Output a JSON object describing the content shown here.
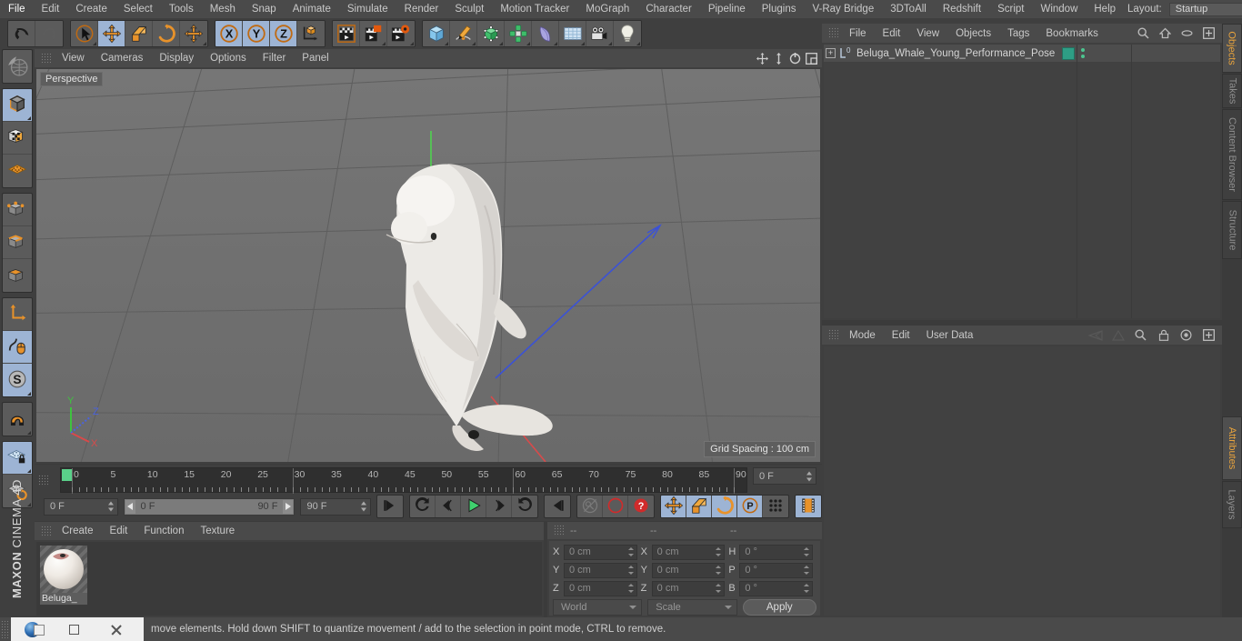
{
  "app": {
    "brand_maxon": "MAXON",
    "brand_product": "CINEMA 4D"
  },
  "menubar": {
    "items": [
      "File",
      "Edit",
      "Create",
      "Select",
      "Tools",
      "Mesh",
      "Snap",
      "Animate",
      "Simulate",
      "Render",
      "Sculpt",
      "Motion Tracker",
      "MoGraph",
      "Character",
      "Pipeline",
      "Plugins",
      "V-Ray Bridge",
      "3DToAll",
      "Redshift",
      "Script",
      "Window",
      "Help"
    ],
    "layout_label": "Layout:",
    "layout_value": "Startup",
    "icons": [
      "search-icon",
      "home-icon",
      "minimize-icon",
      "maximize-icon"
    ]
  },
  "toolbar": {
    "groups": [
      {
        "name": "undo-redo",
        "buttons": [
          {
            "name": "undo-button",
            "icon": "undo-arrow-icon",
            "active": false,
            "corner": false
          },
          {
            "name": "redo-button",
            "icon": "redo-arrow-icon",
            "active": false,
            "corner": false
          }
        ]
      },
      {
        "name": "transform-tools",
        "buttons": [
          {
            "name": "live-selection-tool",
            "icon": "cursor-circle-icon",
            "active": false,
            "corner": true
          },
          {
            "name": "move-tool",
            "icon": "move-arrows-icon",
            "active": true,
            "corner": false
          },
          {
            "name": "scale-tool",
            "icon": "scale-box-icon",
            "active": false,
            "corner": false
          },
          {
            "name": "rotate-tool",
            "icon": "rotate-arc-icon",
            "active": false,
            "corner": false
          },
          {
            "name": "dynamic-place-tool",
            "icon": "move-arrows-icon",
            "active": false,
            "corner": true
          }
        ]
      },
      {
        "name": "axis-locks",
        "buttons": [
          {
            "name": "lock-x-axis",
            "icon": "x-axis-icon",
            "active": true,
            "corner": false
          },
          {
            "name": "lock-y-axis",
            "icon": "y-axis-icon",
            "active": true,
            "corner": false
          },
          {
            "name": "lock-z-axis",
            "icon": "z-axis-icon",
            "active": true,
            "corner": false
          },
          {
            "name": "world-object-coordinates",
            "icon": "world-axis-cube-icon",
            "active": false,
            "corner": false
          }
        ]
      },
      {
        "name": "render-tools",
        "buttons": [
          {
            "name": "render-view-button",
            "icon": "render-view-icon",
            "active": false,
            "corner": false
          },
          {
            "name": "render-region-button",
            "icon": "render-region-icon",
            "active": false,
            "corner": true
          },
          {
            "name": "render-settings-button",
            "icon": "render-settings-gear-icon",
            "active": false,
            "corner": true
          }
        ]
      },
      {
        "name": "create-objects",
        "buttons": [
          {
            "name": "add-cube-button",
            "icon": "cube-icon",
            "active": false,
            "corner": true
          },
          {
            "name": "add-spline-button",
            "icon": "pen-spline-icon",
            "active": false,
            "corner": true
          },
          {
            "name": "add-generator-button",
            "icon": "green-cube-generator-icon",
            "active": false,
            "corner": true
          },
          {
            "name": "add-array-button",
            "icon": "array-cluster-icon",
            "active": false,
            "corner": true
          },
          {
            "name": "add-deformer-button",
            "icon": "bend-deformer-icon",
            "active": false,
            "corner": true
          },
          {
            "name": "add-environment-button",
            "icon": "floor-grid-icon",
            "active": false,
            "corner": true
          },
          {
            "name": "add-camera-button",
            "icon": "camera-icon",
            "active": false,
            "corner": true
          },
          {
            "name": "add-light-button",
            "icon": "light-bulb-icon",
            "active": false,
            "corner": true
          }
        ]
      }
    ]
  },
  "left_tools": {
    "groups": [
      {
        "name": "undo-view",
        "buttons": [
          {
            "name": "undo-view-button",
            "icon": "globe-grid-icon",
            "active": false,
            "corner": false
          }
        ]
      },
      {
        "name": "editor-modes",
        "buttons": [
          {
            "name": "make-editable-button",
            "icon": "gray-cube-icon",
            "active": true,
            "corner": true
          },
          {
            "name": "texture-mode-button",
            "icon": "checker-cube-icon",
            "active": false,
            "corner": false
          },
          {
            "name": "viewport-solo-button",
            "icon": "orange-grid-plane-icon",
            "active": false,
            "corner": false
          }
        ]
      },
      {
        "name": "component-modes",
        "buttons": [
          {
            "name": "points-mode-button",
            "icon": "cube-points-icon",
            "active": false,
            "corner": false
          },
          {
            "name": "edges-mode-button",
            "icon": "cube-edges-icon",
            "active": false,
            "corner": false
          },
          {
            "name": "polygons-mode-button",
            "icon": "cube-polygons-icon",
            "active": false,
            "corner": false
          }
        ]
      },
      {
        "name": "axis-modes",
        "buttons": [
          {
            "name": "enable-axis-button",
            "icon": "axis-corner-icon",
            "active": false,
            "corner": false
          },
          {
            "name": "enable-snap-button",
            "icon": "mouse-spline-icon",
            "active": true,
            "corner": false
          },
          {
            "name": "soft-selection-button",
            "icon": "s-circle-icon",
            "active": true,
            "corner": true
          }
        ]
      },
      {
        "name": "magnet-group",
        "buttons": [
          {
            "name": "magnet-tool-button",
            "icon": "magnet-icon",
            "active": false,
            "corner": true
          }
        ]
      },
      {
        "name": "workplane-group",
        "buttons": [
          {
            "name": "lock-workplane-button",
            "icon": "workplane-lock-icon",
            "active": true,
            "corner": true
          },
          {
            "name": "workplane-rotate-button",
            "icon": "workplane-rotate-icon",
            "active": false,
            "corner": true
          }
        ]
      }
    ]
  },
  "viewport": {
    "menu": [
      "View",
      "Cameras",
      "Display",
      "Options",
      "Filter",
      "Panel"
    ],
    "nav_icons": [
      "pan-icon",
      "dolly-icon",
      "orbit-icon",
      "maximize-view-icon"
    ],
    "label": "Perspective",
    "grid_spacing": "Grid Spacing : 100 cm",
    "axis_labels": {
      "x": "X",
      "y": "Y",
      "z": "Z"
    },
    "axis_colors": {
      "x": "#d84a4a",
      "y": "#3fc23f",
      "z": "#4a63e0"
    },
    "subject": "beluga-whale-model"
  },
  "timeline": {
    "ticks": [
      {
        "label": "0",
        "value": 0
      },
      {
        "label": "5",
        "value": 5
      },
      {
        "label": "10",
        "value": 10
      },
      {
        "label": "15",
        "value": 15
      },
      {
        "label": "20",
        "value": 20
      },
      {
        "label": "25",
        "value": 25
      },
      {
        "label": "30",
        "value": 30
      },
      {
        "label": "35",
        "value": 35
      },
      {
        "label": "40",
        "value": 40
      },
      {
        "label": "45",
        "value": 45
      },
      {
        "label": "50",
        "value": 50
      },
      {
        "label": "55",
        "value": 55
      },
      {
        "label": "60",
        "value": 60
      },
      {
        "label": "65",
        "value": 65
      },
      {
        "label": "70",
        "value": 70
      },
      {
        "label": "75",
        "value": 75
      },
      {
        "label": "80",
        "value": 80
      },
      {
        "label": "85",
        "value": 85
      },
      {
        "label": "90",
        "value": 90
      }
    ],
    "range_min": 0,
    "range_max": 90,
    "current_frame_field": "0 F",
    "start_frame_field": "0 F",
    "range_start_label": "0 F",
    "range_end_label": "90 F",
    "end_frame_field": "90 F",
    "playback_buttons": [
      {
        "name": "go-to-start-button",
        "icon": "skip-start-icon",
        "active": false
      },
      {
        "name": "previous-keyframe-button",
        "icon": "prev-key-icon",
        "active": false
      },
      {
        "name": "previous-frame-button",
        "icon": "step-back-icon",
        "active": false
      },
      {
        "name": "play-button",
        "icon": "play-icon",
        "active": false
      },
      {
        "name": "next-frame-button",
        "icon": "step-forward-icon",
        "active": false
      },
      {
        "name": "next-keyframe-button",
        "icon": "next-key-icon",
        "active": false
      },
      {
        "name": "go-to-end-button",
        "icon": "skip-end-icon",
        "active": false
      },
      {
        "name": "record-active-objects-button",
        "icon": "key-disabled-icon",
        "active": false
      },
      {
        "name": "autokeying-button",
        "icon": "autokey-red-icon",
        "active": false
      },
      {
        "name": "keyframe-selection-button",
        "icon": "question-red-icon",
        "active": false
      },
      {
        "name": "position-key-button",
        "icon": "move-arrows-icon",
        "active": true
      },
      {
        "name": "scale-key-button",
        "icon": "scale-box-icon",
        "active": true
      },
      {
        "name": "rotation-key-button",
        "icon": "rotate-arc-icon",
        "active": true
      },
      {
        "name": "pla-key-button",
        "icon": "p-circle-icon",
        "active": true
      },
      {
        "name": "point-level-animation-button",
        "icon": "dot-matrix-icon",
        "active": false
      },
      {
        "name": "animation-mode-button",
        "icon": "film-strip-icon",
        "active": true
      }
    ]
  },
  "material_manager": {
    "menu": [
      "Create",
      "Edit",
      "Function",
      "Texture"
    ],
    "materials": [
      {
        "name": "Beluga_"
      }
    ]
  },
  "coordinate_manager": {
    "header": [
      "--",
      "--",
      "--"
    ],
    "rows": [
      {
        "pos_label": "X",
        "pos_value": "0 cm",
        "size_label": "X",
        "size_value": "0 cm",
        "rot_label": "H",
        "rot_value": "0 °"
      },
      {
        "pos_label": "Y",
        "pos_value": "0 cm",
        "size_label": "Y",
        "size_value": "0 cm",
        "rot_label": "P",
        "rot_value": "0 °"
      },
      {
        "pos_label": "Z",
        "pos_value": "0 cm",
        "size_label": "Z",
        "size_value": "0 cm",
        "rot_label": "B",
        "rot_value": "0 °"
      }
    ],
    "system_dropdown": "World",
    "mode_dropdown": "Scale",
    "apply_button": "Apply"
  },
  "object_manager": {
    "menu": [
      "File",
      "Edit",
      "View",
      "Objects",
      "Tags",
      "Bookmarks"
    ],
    "icons": [
      "search-icon",
      "home-icon",
      "eye-icon",
      "plus-box-icon"
    ],
    "object_name": "Beluga_Whale_Young_Performance_Pose",
    "object_level": "0",
    "expander": "+"
  },
  "attributes_manager": {
    "menu": [
      "Mode",
      "Edit",
      "User Data"
    ],
    "icons": [
      "back-nav-icon",
      "forward-nav-icon",
      "search-icon",
      "lock-icon",
      "target-icon",
      "plus-box-icon"
    ]
  },
  "dock_tabs": [
    {
      "label": "Objects",
      "active": true
    },
    {
      "label": "Takes",
      "active": false
    },
    {
      "label": "Content Browser",
      "active": false
    },
    {
      "label": "Structure",
      "active": false
    },
    {
      "label": "Attributes",
      "active": true
    },
    {
      "label": "Layers",
      "active": false
    }
  ],
  "statusbar": {
    "message": "move elements. Hold down SHIFT to quantize movement / add to the selection in point mode, CTRL to remove."
  },
  "taskbar": {
    "buttons": [
      "c4d-app-icon",
      "restore-window-icon",
      "close-window-icon"
    ]
  },
  "colors": {
    "accent_orange": "#e8922a",
    "active_blue": "#9db4d4",
    "panel_bg": "#3f3f3f",
    "menu_bg": "#4a4a4a",
    "viewport_bg": "#6e6e6e",
    "green_playhead": "#5ad18a",
    "tag_teal": "#2e9e85"
  }
}
